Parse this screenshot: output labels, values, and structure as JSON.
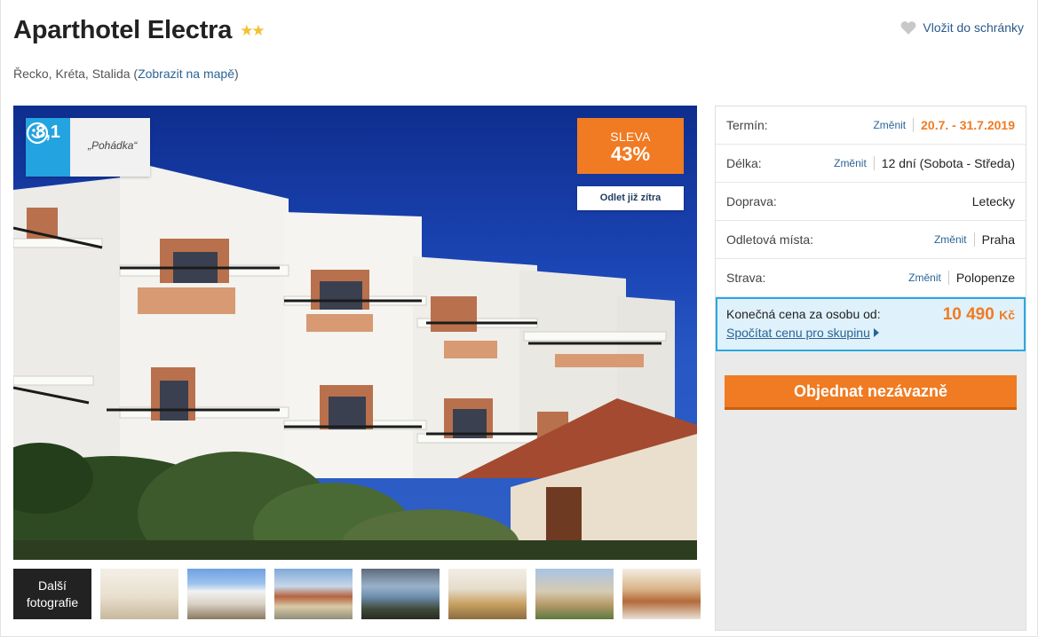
{
  "hotel": {
    "name": "Aparthotel Electra",
    "stars": "★★",
    "location_prefix": "Řecko, Kréta, Stalida (",
    "map_link": "Zobrazit na mapě",
    "location_suffix": ")"
  },
  "favorite": {
    "label": "Vložit do schránky",
    "icon": "heart-icon"
  },
  "rating": {
    "score": "8,1",
    "label": "„Pohádka“",
    "icon": "smiley-icon"
  },
  "sale": {
    "line1": "SLEVA",
    "line2": "43%",
    "depart_label": "Odlet již zítra"
  },
  "gallery": {
    "more_label_1": "Další",
    "more_label_2": "fotografie"
  },
  "details": [
    {
      "label": "Termín:",
      "change": "Změnit",
      "value": "20.7. - 31.7.2019"
    },
    {
      "label": "Délka:",
      "change": "Změnit",
      "value": "12 dní (Sobota - Středa)"
    },
    {
      "label": "Doprava:",
      "value": "Letecky"
    },
    {
      "label": "Odletová místa:",
      "change": "Změnit",
      "value": "Praha"
    },
    {
      "label": "Strava:",
      "change": "Změnit",
      "value": "Polopenze"
    }
  ],
  "price": {
    "label": "Konečná cena za osobu od:",
    "amount": "10 490",
    "currency": "Kč",
    "group_link": "Spočítat cenu pro skupinu"
  },
  "order_button": "Objednat nezávazně",
  "colors": {
    "accent": "#f07b22",
    "link": "#2a6496",
    "rating": "#23a3e0",
    "price_border": "#2aa8e0"
  }
}
